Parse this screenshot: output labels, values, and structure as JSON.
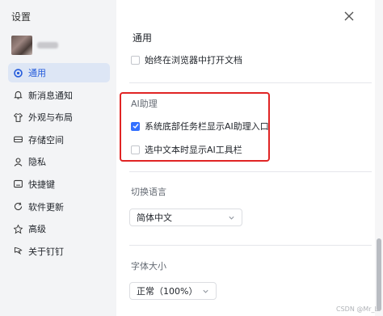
{
  "window": {
    "title": "设置"
  },
  "sidebar": {
    "items": [
      {
        "label": "通用",
        "icon": "settings-icon",
        "active": true
      },
      {
        "label": "新消息通知",
        "icon": "bell-icon"
      },
      {
        "label": "外观与布局",
        "icon": "shirt-icon"
      },
      {
        "label": "存储空间",
        "icon": "storage-icon"
      },
      {
        "label": "隐私",
        "icon": "user-icon"
      },
      {
        "label": "快捷键",
        "icon": "keyboard-icon"
      },
      {
        "label": "软件更新",
        "icon": "update-icon"
      },
      {
        "label": "高级",
        "icon": "advanced-icon"
      },
      {
        "label": "关于钉钉",
        "icon": "dingtalk-icon"
      }
    ]
  },
  "main": {
    "general": {
      "title": "通用",
      "open_in_browser": {
        "label": "始终在浏览器中打开文档",
        "checked": false
      }
    },
    "ai": {
      "title": "AI助理",
      "taskbar_entry": {
        "label": "系统底部任务栏显示AI助理入口",
        "checked": true
      },
      "toolbar_on_select": {
        "label": "选中文本时显示AI工具栏",
        "checked": false
      }
    },
    "language": {
      "title": "切换语言",
      "value": "简体中文"
    },
    "font_size": {
      "title": "字体大小",
      "value": "正常（100%）"
    }
  },
  "watermark": "CSDN @Mr_L",
  "colors": {
    "accent": "#3370ff",
    "highlight_border": "#e02424",
    "sidebar_bg": "#f3f4f6"
  }
}
